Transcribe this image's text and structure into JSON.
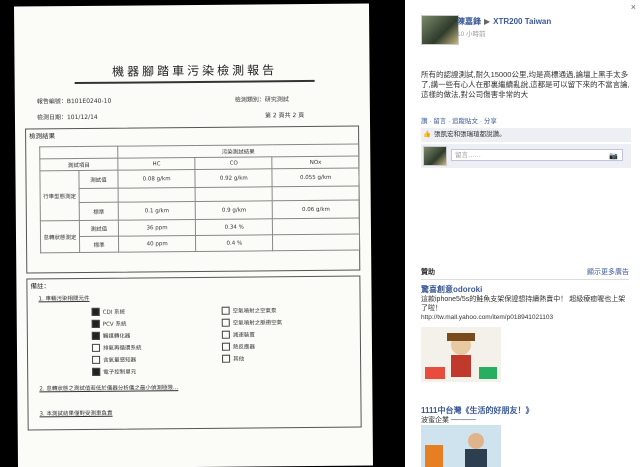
{
  "document": {
    "title": "機器腳踏車污染檢測報告",
    "report_no_label": "報告編號：B101E0240-10",
    "test_date_label": "檢測日期：101/12/14",
    "category_label": "檢測類別：研究測試",
    "page_label": "第 2 頁共 2 頁",
    "results_section": "檢測結果",
    "results_header": "污染測試結果",
    "col_item": "測試項目",
    "col_hc": "HC",
    "col_co": "CO",
    "col_nox": "NOx",
    "rows": [
      {
        "group": "行車型態測定",
        "label": "測試值",
        "hc": "0.08 g/km",
        "co": "0.92 g/km",
        "nox": "0.055 g/km"
      },
      {
        "group": "",
        "label": "",
        "hc": "",
        "co": "",
        "nox": ""
      },
      {
        "group": "",
        "label": "標準",
        "hc": "0.1 g/km",
        "co": "0.9 g/km",
        "nox": "0.06 g/km"
      },
      {
        "group": "怠轉狀態測定",
        "label": "測試值",
        "hc": "36 ppm",
        "co": "0.34 %",
        "nox": ""
      },
      {
        "group": "",
        "label": "標準",
        "hc": "40 ppm",
        "co": "0.4 %",
        "nox": ""
      }
    ],
    "notes_section": "備註：",
    "note1": "1. 車輛污染相關元件",
    "checklist_left": [
      "CDI 系統",
      "PCV 系統",
      "觸媒轉化器",
      "排氣再循環系統",
      "含氧量感知器",
      "電子控制單元"
    ],
    "checklist_left_filled": [
      true,
      true,
      true,
      false,
      false,
      true
    ],
    "checklist_right": [
      "空氣噴射之空氣泵",
      "空氣噴射之脈衝空氣",
      "減速裝置",
      "熱反應器",
      "其他"
    ],
    "note2": "2. 怠轉狀態之測試值若低於儀器分析儀之最小偵測極限…",
    "note3": "3. 本測試結果僅對受測車負責"
  },
  "panel": {
    "close_label": "×",
    "author": "陳嘉鋒",
    "page_name": "XTR200 Taiwan",
    "arrow": "▶",
    "time": "10 小時前",
    "post_text": "所有的認證測試,耐久15000公里,均是高標通過,論壇上黑手太多了,講一些有心人在那裏繼續亂說,這都是可以留下來的不當言論,這樣的做法,對公司傷害非常的大",
    "actions": "讚 · 留言 · 追蹤貼文 · 分享",
    "like_text": "張凱宏和張瑞瑄都說讚。",
    "comment_placeholder": "留言……",
    "sponsored_label": "贊助",
    "create_ad_label": "顯示更多廣告",
    "ad1_title": "驚喜創意odoroki",
    "ad1_text": "這款iphone5/5s的鮭魚支架保證想持續熱賣中！ 超級療癒喔也上架了啦！",
    "ad1_url": "http://tw.mall.yahoo.com/item/p018941021103",
    "ad2_title": "1111中台灣《生活的好朋友！》",
    "ad2_text": "波蜜企業 ─────"
  },
  "colors": {
    "link": "#3b5998",
    "panel_bg": "#ffffff"
  },
  "icons": {
    "thumb": "thumbs-up-icon",
    "camera": "camera-icon",
    "close": "close-icon"
  }
}
